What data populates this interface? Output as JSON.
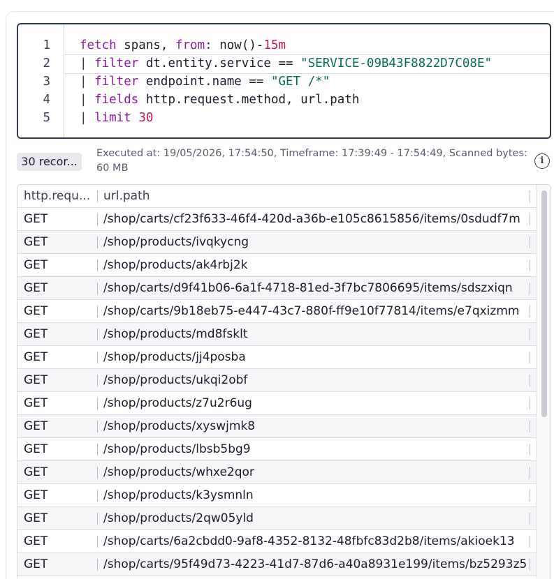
{
  "query": {
    "lines": [
      {
        "num": "1",
        "tokens": [
          [
            "kw",
            "fetch"
          ],
          [
            "plain",
            " spans, "
          ],
          [
            "kw",
            "from"
          ],
          [
            "plain",
            ": now()-"
          ],
          [
            "num",
            "15m"
          ]
        ]
      },
      {
        "num": "2",
        "tokens": [
          [
            "pipe",
            "| "
          ],
          [
            "kw",
            "filter"
          ],
          [
            "plain",
            " dt.entity.service == "
          ],
          [
            "str",
            "\"SERVICE-09B43F8822D7C08E\""
          ]
        ]
      },
      {
        "num": "3",
        "tokens": [
          [
            "pipe",
            "| "
          ],
          [
            "kw",
            "filter"
          ],
          [
            "plain",
            " endpoint.name == "
          ],
          [
            "str",
            "\"GET /*\""
          ]
        ]
      },
      {
        "num": "4",
        "tokens": [
          [
            "pipe",
            "| "
          ],
          [
            "kw",
            "fields"
          ],
          [
            "plain",
            " http.request.method, url.path"
          ]
        ]
      },
      {
        "num": "5",
        "tokens": [
          [
            "pipe",
            "| "
          ],
          [
            "kw",
            "limit"
          ],
          [
            "plain",
            " "
          ],
          [
            "num",
            "30"
          ]
        ]
      }
    ]
  },
  "result": {
    "records_label": "30 recor...",
    "exec_info": "Executed at: 19/05/2026, 17:54:50, Timeframe: 17:39:49 - 17:54:49, Scanned bytes: 60 MB",
    "info_icon": "i",
    "columns": [
      "http.requ...",
      "url.path"
    ],
    "rows": [
      [
        "GET",
        "/shop/carts/cf23f633-46f4-420d-a36b-e105c8615856/items/0sdudf7m"
      ],
      [
        "GET",
        "/shop/products/ivqkycng"
      ],
      [
        "GET",
        "/shop/products/ak4rbj2k"
      ],
      [
        "GET",
        "/shop/carts/d9f41b06-6a1f-4718-81ed-3f7bc7806695/items/sdszxiqn"
      ],
      [
        "GET",
        "/shop/carts/9b18eb75-e447-43c7-880f-ff9e10f77814/items/e7qxizmm"
      ],
      [
        "GET",
        "/shop/products/md8fsklt"
      ],
      [
        "GET",
        "/shop/products/jj4posba"
      ],
      [
        "GET",
        "/shop/products/ukqi2obf"
      ],
      [
        "GET",
        "/shop/products/z7u2r6ug"
      ],
      [
        "GET",
        "/shop/products/xyswjmk8"
      ],
      [
        "GET",
        "/shop/products/lbsb5bg9"
      ],
      [
        "GET",
        "/shop/products/whxe2qor"
      ],
      [
        "GET",
        "/shop/products/k3ysmnln"
      ],
      [
        "GET",
        "/shop/products/2qw05yld"
      ],
      [
        "GET",
        "/shop/carts/6a2cbdd0-9af8-4352-8132-48fbfc83d2b8/items/akioek13"
      ],
      [
        "GET",
        "/shop/carts/95f49d73-4223-41d7-87d6-a40a8931e199/items/bz5293z5"
      ]
    ]
  }
}
